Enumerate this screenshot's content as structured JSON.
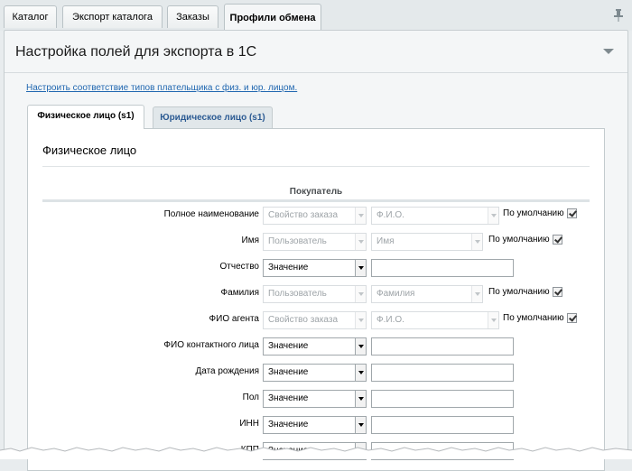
{
  "top_tabs": [
    {
      "label": "Каталог"
    },
    {
      "label": "Экспорт каталога"
    },
    {
      "label": "Заказы"
    },
    {
      "label": "Профили обмена"
    }
  ],
  "panel": {
    "title": "Настройка полей для экспорта в 1С",
    "link": "Настроить соответствие типов плательщика с физ. и юр. лицом."
  },
  "inner_tabs": [
    {
      "label": "Физическое лицо (s1)"
    },
    {
      "label": "Юридическое лицо (s1)"
    }
  ],
  "section": {
    "title": "Физическое лицо",
    "group": "Покупатель",
    "default_label": "По умолчанию"
  },
  "rows": [
    {
      "label": "Полное наименование",
      "type": "Свойство заказа",
      "value": "Ф.И.О."
    },
    {
      "label": "Имя",
      "type": "Пользователь",
      "value": "Имя"
    },
    {
      "label": "Отчество",
      "type": "Значение",
      "value": ""
    },
    {
      "label": "Фамилия",
      "type": "Пользователь",
      "value": "Фамилия"
    },
    {
      "label": "ФИО агента",
      "type": "Свойство заказа",
      "value": "Ф.И.О."
    },
    {
      "label": "ФИО контактного лица",
      "type": "Значение",
      "value": ""
    },
    {
      "label": "Дата рождения",
      "type": "Значение",
      "value": ""
    },
    {
      "label": "Пол",
      "type": "Значение",
      "value": ""
    },
    {
      "label": "ИНН",
      "type": "Значение",
      "value": ""
    },
    {
      "label": "КПП",
      "type": "Значение",
      "value": ""
    }
  ],
  "icons": {
    "pin": "pin-icon",
    "collapse": "collapse-arrow-icon"
  }
}
